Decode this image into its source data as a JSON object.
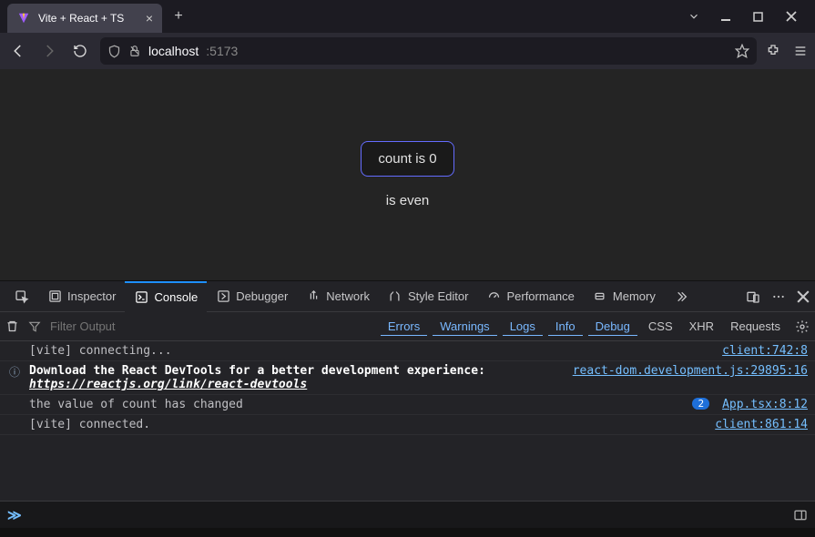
{
  "tab": {
    "title": "Vite + React + TS"
  },
  "url": {
    "host": "localhost",
    "port": ":5173"
  },
  "app": {
    "count_label": "count is 0",
    "even_label": "is even"
  },
  "devtools_tabs": {
    "inspector": "Inspector",
    "console": "Console",
    "debugger": "Debugger",
    "network": "Network",
    "style": "Style Editor",
    "performance": "Performance",
    "memory": "Memory"
  },
  "filter": {
    "placeholder": "Filter Output",
    "chips_blue": [
      "Errors",
      "Warnings",
      "Logs",
      "Info",
      "Debug"
    ],
    "chips_plain": [
      "CSS",
      "XHR",
      "Requests"
    ]
  },
  "messages": [
    {
      "icon": "",
      "text": "[vite] connecting...",
      "src": "client:742:8"
    },
    {
      "icon": "info",
      "bold": "Download the React DevTools for a better development experience: ",
      "link_italic": "https://reactjs.org/link/react-devtools",
      "src": "react-dom.development.js:29895:16"
    },
    {
      "icon": "",
      "text": "the value of count has changed",
      "badge": "2",
      "src": "App.tsx:8:12"
    },
    {
      "icon": "",
      "text": "[vite] connected.",
      "src": "client:861:14"
    }
  ]
}
